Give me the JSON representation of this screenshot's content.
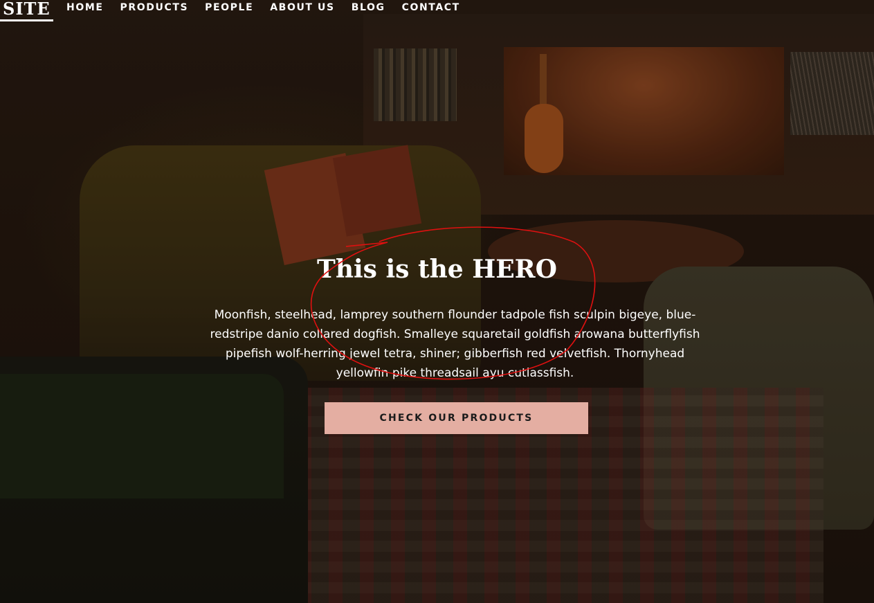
{
  "header": {
    "logo": "SITE",
    "nav": [
      "HOME",
      "PRODUCTS",
      "PEOPLE",
      "ABOUT US",
      "BLOG",
      "CONTACT"
    ]
  },
  "hero": {
    "title": "This is the HERO",
    "body": "Moonfish, steelhead, lamprey southern flounder tadpole fish sculpin bigeye, blue-redstripe danio collared dogfish. Smalleye squaretail goldfish arowana butterflyfish pipefish wolf-herring jewel tetra, shiner; gibberfish red velvetfish. Thornyhead yellowfin pike threadsail ayu cutlassfish.",
    "cta_label": "CHECK OUR PRODUCTS"
  },
  "colors": {
    "cta_background": "#e4aea2",
    "annotation_stroke": "#e01010",
    "text": "#ffffff"
  }
}
